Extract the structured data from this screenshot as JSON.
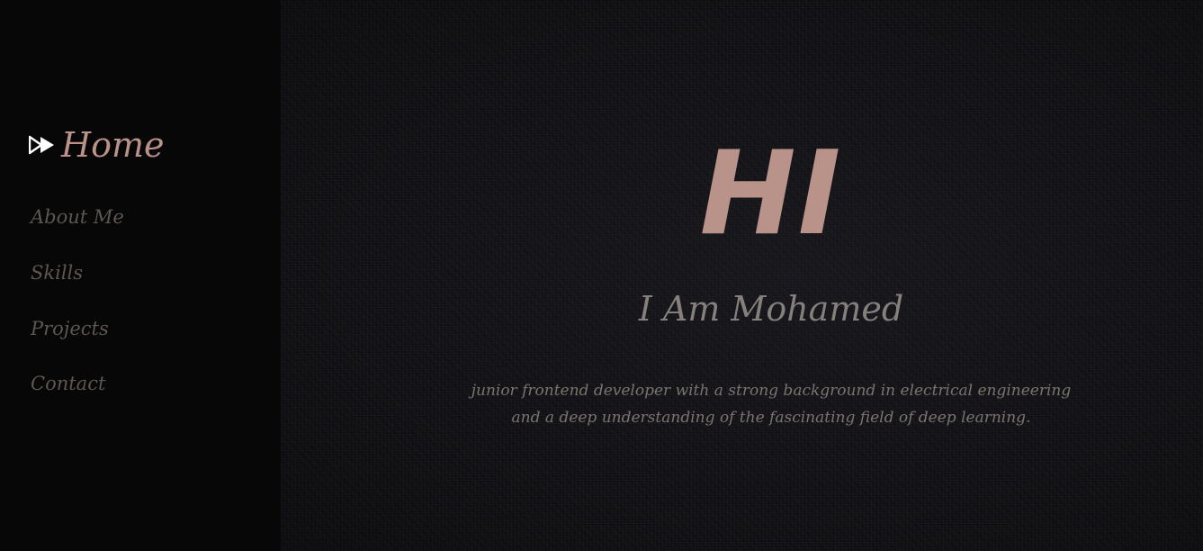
{
  "nav": {
    "active_label": "Home",
    "items": [
      {
        "label": "About Me"
      },
      {
        "label": "Skills"
      },
      {
        "label": "Projects"
      },
      {
        "label": "Contact"
      }
    ]
  },
  "hero": {
    "greeting": "HI",
    "name": "I Am Mohamed",
    "description": "junior frontend developer with a strong background in electrical engineering and a deep understanding of the fascinating field of deep learning."
  },
  "colors": {
    "accent": "#b9928a",
    "sidebar_bg": "#070707",
    "main_bg": "#121216",
    "nav_text": "#5d5651",
    "body_text": "#7a746f"
  },
  "icons": {
    "active_indicator": "double-chevron-right-icon"
  }
}
